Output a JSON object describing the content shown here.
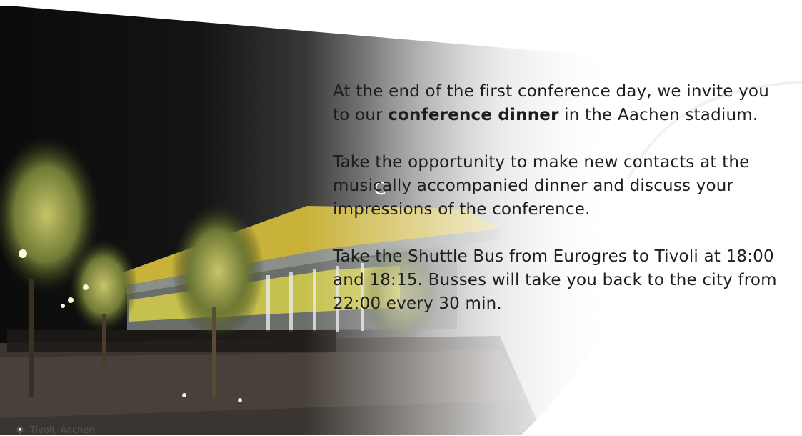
{
  "intro": {
    "part1": "At the end of the first conference day, we invite you to our ",
    "highlight": "conference dinner",
    "part2": " in the Aachen stadium."
  },
  "paragraphs": [
    "Take the opportunity to make new contacts at the musically accompanied dinner and discuss your impressions of the conference.",
    "Take the Shuttle Bus from Eurogres to Tivoli at 18:00 and 18:15. Busses will take you back to the city from 22:00 every 30 min."
  ],
  "location": {
    "icon": "map-pin-icon",
    "label": "Tivoli, Aachen"
  },
  "spinner": {
    "icon": "loading-spinner-icon",
    "glyph": "C"
  },
  "colors": {
    "text": "#1e1e1e",
    "stadium_yellow": "#d8c23a",
    "night_sky": "#0d0d0d"
  }
}
